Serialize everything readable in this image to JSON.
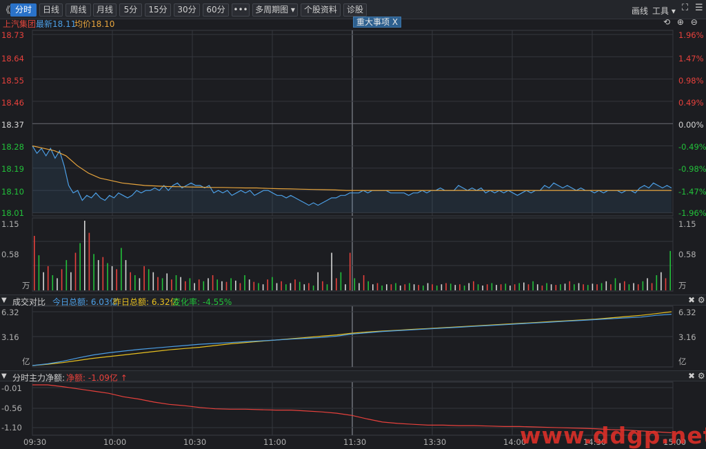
{
  "toolbar": {
    "back_glyph": "《",
    "buttons": [
      "分时",
      "日线",
      "周线",
      "月线",
      "5分",
      "15分",
      "30分",
      "60分",
      "•••",
      "多周期图 ▾",
      "个股资料",
      "诊股"
    ],
    "active_index": 0,
    "draw_label": "画线",
    "tools_label": "工具 ▾",
    "expand_glyph": "⛶",
    "menu_glyph": "☰"
  },
  "info": {
    "stock_name": "上汽集团",
    "latest": "最新18.11",
    "avg": "均价18.10",
    "major_event_tag": "重大事项 X"
  },
  "top_icons": "⟲ ⊕ ⊖",
  "price_axis": {
    "left": [
      "18.73",
      "18.64",
      "18.55",
      "18.46",
      "18.37",
      "18.28",
      "18.19",
      "18.10",
      "18.01"
    ],
    "right": [
      "1.96%",
      "1.47%",
      "0.98%",
      "0.49%",
      "0.00%",
      "-0.49%",
      "-0.98%",
      "-1.47%",
      "-1.96%"
    ]
  },
  "volume_axis": {
    "left": [
      "1.15",
      "0.58",
      "万"
    ],
    "right": [
      "1.15",
      "0.58",
      "万"
    ]
  },
  "turnover_panel": {
    "title": "成交对比",
    "today": "今日总额: 6.03亿",
    "yesterday": "昨日总额: 6.32亿",
    "change": "变化率: -4.55%",
    "axis_left": [
      "6.32",
      "3.16",
      "亿"
    ],
    "axis_right": [
      "6.32",
      "3.16",
      "亿"
    ]
  },
  "mainforce_panel": {
    "title": "分时主力净额:",
    "net": "净额: -1.09亿 ↑",
    "axis_left": [
      "-0.01",
      "-0.56",
      "-1.10"
    ]
  },
  "panel_ctrl": "✖ ⚙",
  "time_axis": [
    "09:30",
    "10:00",
    "10:30",
    "11:00",
    "11:30",
    "13:30",
    "14:00",
    "14:30",
    "15:00"
  ],
  "watermark": "www.ddgp.net",
  "colors": {
    "price_line": "#4c9fe6",
    "avg_line": "#e8a53d",
    "up": "#e8413c",
    "down": "#22c23a",
    "today_line": "#4c9fe6",
    "yesterday_line": "#e8c020",
    "mainforce_line": "#e8413c"
  },
  "chart_data": {
    "type": "line",
    "prev_close": 18.37,
    "ylim": [
      18.01,
      18.73
    ],
    "price_series": [
      {
        "name": "最新",
        "values": [
          18.28,
          18.25,
          18.27,
          18.24,
          18.27,
          18.23,
          18.26,
          18.2,
          18.12,
          18.09,
          18.1,
          18.06,
          18.08,
          18.07,
          18.09,
          18.07,
          18.06,
          18.08,
          18.07,
          18.09,
          18.08,
          18.07,
          18.08,
          18.1,
          18.09,
          18.1,
          18.1,
          18.11,
          18.1,
          18.12,
          18.1,
          18.12,
          18.13,
          18.11,
          18.12,
          18.13,
          18.12,
          18.12,
          18.11,
          18.12,
          18.09,
          18.1,
          18.09,
          18.1,
          18.08,
          18.09,
          18.1,
          18.09,
          18.1,
          18.08,
          18.09,
          18.1,
          18.1,
          18.09,
          18.08,
          18.08,
          18.07,
          18.08,
          18.07,
          18.06,
          18.05,
          18.04,
          18.05,
          18.04,
          18.05,
          18.06,
          18.07,
          18.07,
          18.08,
          18.08,
          18.09,
          18.09,
          18.09,
          18.1,
          18.09,
          18.1,
          18.1,
          18.1,
          18.1,
          18.09,
          18.09,
          18.09,
          18.09,
          18.08,
          18.09,
          18.09,
          18.1,
          18.09,
          18.1,
          18.1,
          18.11,
          18.1,
          18.1,
          18.1,
          18.12,
          18.11,
          18.1,
          18.11,
          18.1,
          18.11,
          18.09,
          18.1,
          18.09,
          18.1,
          18.09,
          18.1,
          18.09,
          18.08,
          18.09,
          18.1,
          18.09,
          18.1,
          18.1,
          18.12,
          18.11,
          18.13,
          18.12,
          18.11,
          18.12,
          18.11,
          18.1,
          18.11,
          18.1,
          18.1,
          18.09,
          18.1,
          18.09,
          18.1,
          18.1,
          18.1,
          18.09,
          18.1,
          18.1,
          18.09,
          18.11,
          18.12,
          18.11,
          18.13,
          18.12,
          18.11,
          18.12,
          18.11
        ]
      }
    ],
    "avg_series": [
      18.28,
      18.27,
      18.26,
      18.24,
      18.2,
      18.17,
      18.15,
      18.14,
      18.13,
      18.125,
      18.12,
      18.118,
      18.116,
      18.115,
      18.114,
      18.113,
      18.112,
      18.112,
      18.111,
      18.11,
      18.11,
      18.108,
      18.107,
      18.106,
      18.105,
      18.104,
      18.103,
      18.102,
      18.1,
      18.1,
      18.1,
      18.1,
      18.1,
      18.1,
      18.1,
      18.1,
      18.1,
      18.1,
      18.1,
      18.1,
      18.1,
      18.1,
      18.1,
      18.1,
      18.1,
      18.1,
      18.1,
      18.1,
      18.1,
      18.1,
      18.1,
      18.1,
      18.1,
      18.1,
      18.1,
      18.1,
      18.1,
      18.1
    ],
    "volume": [
      0.9,
      0.58,
      0.3,
      0.4,
      0.25,
      0.2,
      0.35,
      0.5,
      0.3,
      0.62,
      0.78,
      1.15,
      0.95,
      0.6,
      0.5,
      0.55,
      0.45,
      0.4,
      0.35,
      0.7,
      0.5,
      0.3,
      0.25,
      0.2,
      0.4,
      0.35,
      0.3,
      0.22,
      0.2,
      0.28,
      0.18,
      0.25,
      0.22,
      0.15,
      0.2,
      0.12,
      0.18,
      0.15,
      0.2,
      0.25,
      0.18,
      0.15,
      0.14,
      0.2,
      0.16,
      0.12,
      0.25,
      0.18,
      0.14,
      0.12,
      0.1,
      0.18,
      0.22,
      0.12,
      0.15,
      0.1,
      0.12,
      0.18,
      0.14,
      0.1,
      0.12,
      0.08,
      0.3,
      0.15,
      0.1,
      0.62,
      0.2,
      0.3,
      0.1,
      0.62,
      0.2,
      0.12,
      0.25,
      0.15,
      0.1,
      0.12,
      0.08,
      0.1,
      0.1,
      0.12,
      0.08,
      0.1,
      0.12,
      0.1,
      0.09,
      0.08,
      0.12,
      0.1,
      0.08,
      0.1,
      0.12,
      0.11,
      0.09,
      0.1,
      0.08,
      0.12,
      0.15,
      0.1,
      0.08,
      0.1,
      0.12,
      0.09,
      0.1,
      0.11,
      0.08,
      0.1,
      0.12,
      0.13,
      0.1,
      0.15,
      0.1,
      0.08,
      0.12,
      0.1,
      0.09,
      0.1,
      0.11,
      0.15,
      0.1,
      0.12,
      0.1,
      0.09,
      0.11,
      0.1,
      0.12,
      0.15,
      0.1,
      0.2,
      0.12,
      0.15,
      0.1,
      0.12,
      0.1,
      0.15,
      0.2,
      0.12,
      0.25,
      0.3,
      0.2,
      0.65
    ],
    "volume_ylim": [
      0,
      1.15
    ],
    "turnover_ylim": [
      0,
      6.32
    ],
    "today_turnover": [
      0,
      0.2,
      0.5,
      0.9,
      1.25,
      1.5,
      1.7,
      1.9,
      2.05,
      2.2,
      2.35,
      2.5,
      2.6,
      2.7,
      2.8,
      2.9,
      3.0,
      3.1,
      3.2,
      3.3,
      3.45,
      3.7,
      3.85,
      4.0,
      4.1,
      4.2,
      4.3,
      4.4,
      4.5,
      4.6,
      4.7,
      4.8,
      4.9,
      5.0,
      5.1,
      5.2,
      5.3,
      5.4,
      5.5,
      5.6,
      5.7,
      5.9,
      6.03
    ],
    "yesterday_turnover": [
      0,
      0.15,
      0.35,
      0.6,
      0.85,
      1.05,
      1.25,
      1.45,
      1.65,
      1.85,
      2.0,
      2.15,
      2.35,
      2.55,
      2.7,
      2.85,
      3.0,
      3.15,
      3.3,
      3.45,
      3.6,
      3.8,
      3.95,
      4.05,
      4.15,
      4.25,
      4.35,
      4.45,
      4.55,
      4.65,
      4.75,
      4.85,
      4.95,
      5.05,
      5.15,
      5.25,
      5.35,
      5.45,
      5.6,
      5.75,
      5.9,
      6.1,
      6.32
    ],
    "mainforce_ylim": [
      -1.1,
      -0.01
    ],
    "mainforce_series": [
      -0.01,
      -0.01,
      -0.05,
      -0.1,
      -0.15,
      -0.2,
      -0.28,
      -0.33,
      -0.4,
      -0.45,
      -0.48,
      -0.52,
      -0.55,
      -0.56,
      -0.56,
      -0.57,
      -0.58,
      -0.58,
      -0.6,
      -0.62,
      -0.65,
      -0.7,
      -0.78,
      -0.85,
      -0.88,
      -0.9,
      -0.92,
      -0.92,
      -0.93,
      -0.93,
      -0.94,
      -0.95,
      -0.95,
      -0.96,
      -0.97,
      -0.98,
      -0.99,
      -1.0,
      -1.02,
      -1.03,
      -1.05,
      -1.07,
      -1.09
    ]
  }
}
